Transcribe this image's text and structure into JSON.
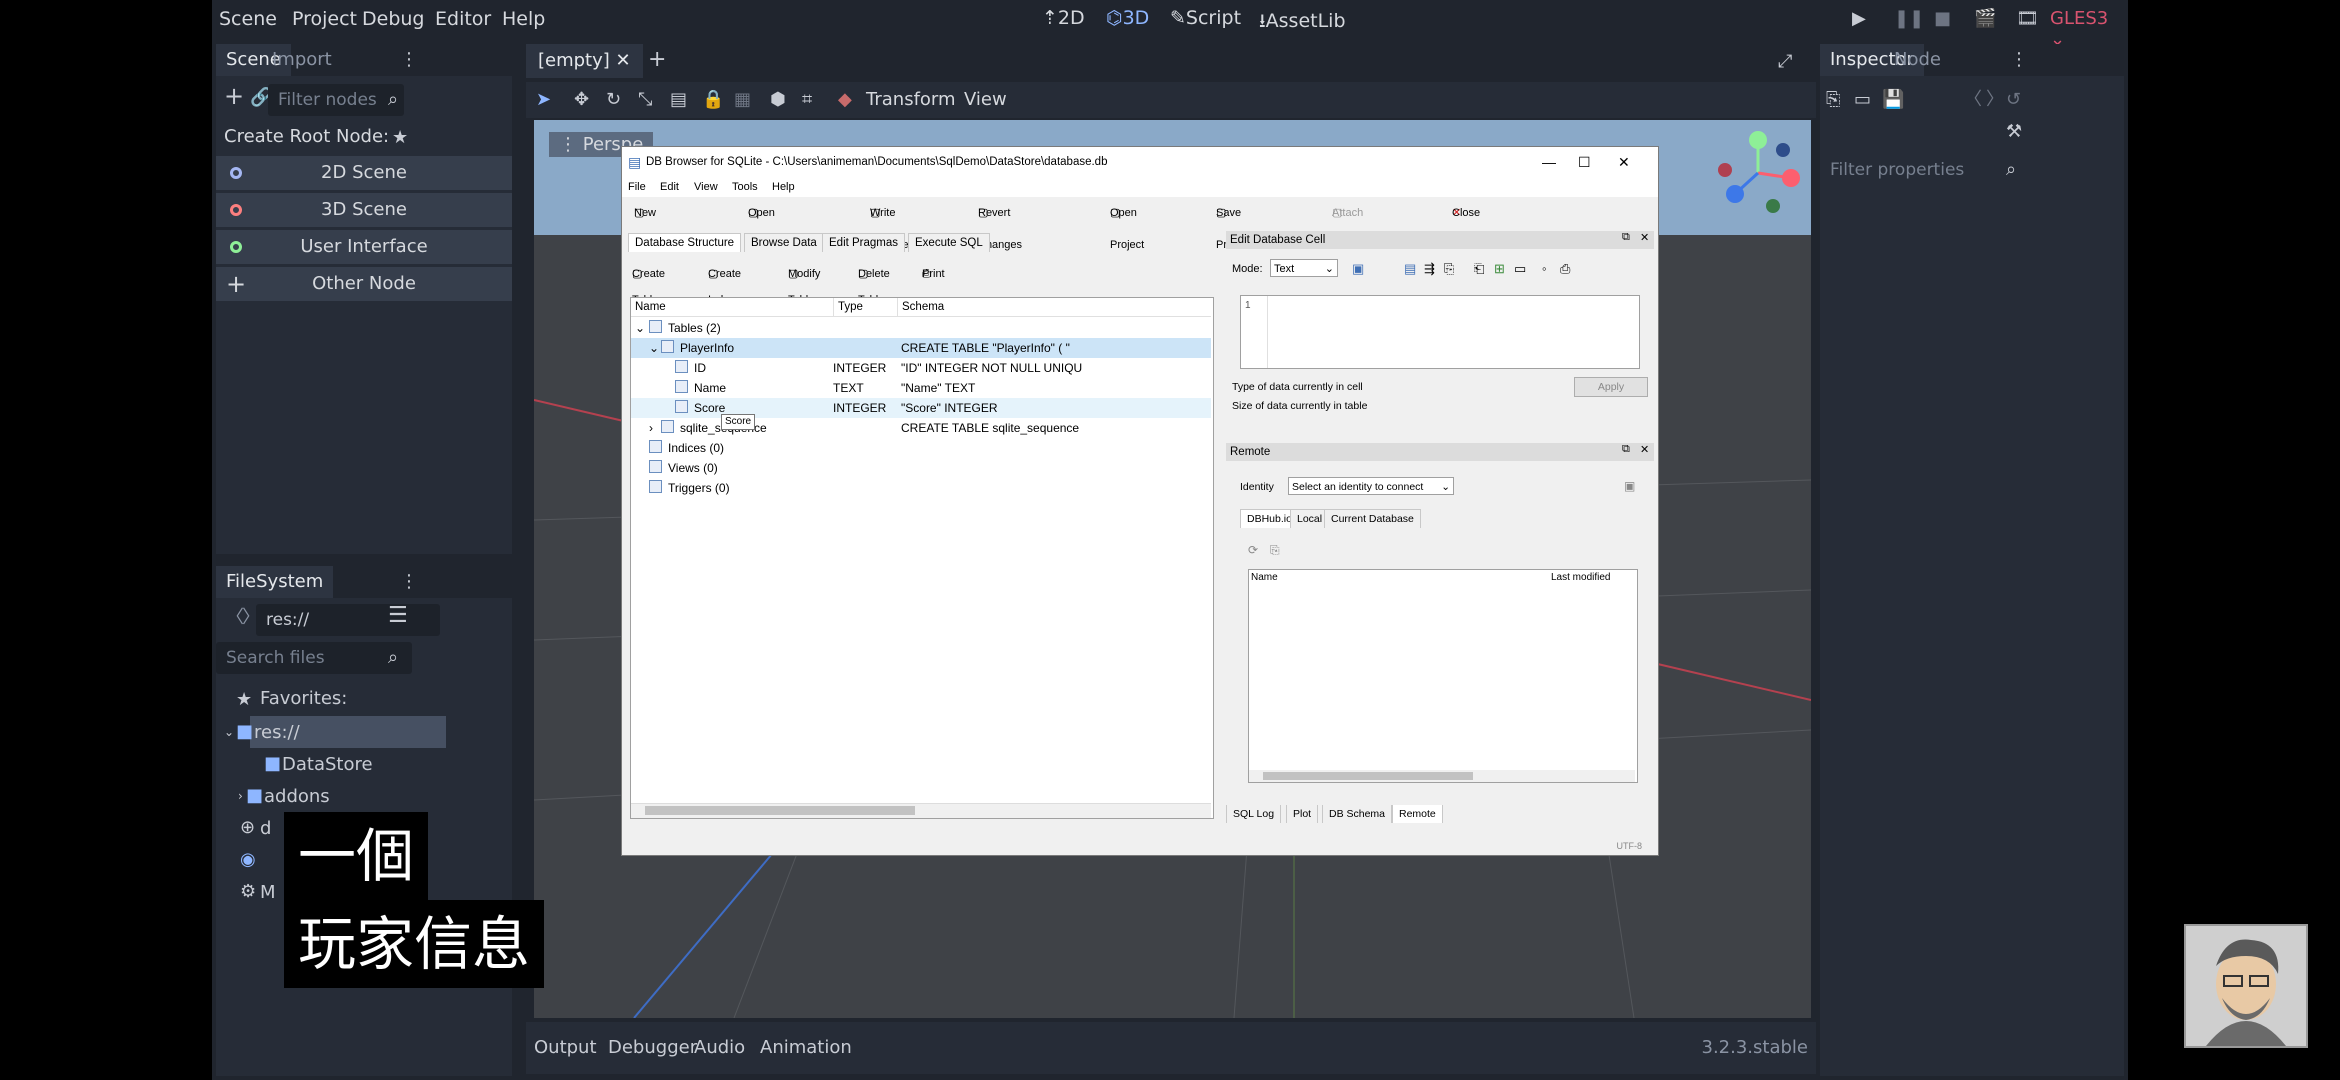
{
  "menu": [
    "Scene",
    "Project",
    "Debug",
    "Editor",
    "Help"
  ],
  "modes": [
    {
      "icon": "2d-mode-icon",
      "glyph": "⇡",
      "label": "2D"
    },
    {
      "icon": "3d-mode-icon",
      "glyph": "⌬",
      "label": "3D"
    },
    {
      "icon": "script-icon",
      "glyph": "✎",
      "label": "Script"
    },
    {
      "icon": "assetlib-icon",
      "glyph": "⭳",
      "label": "AssetLib"
    }
  ],
  "renderer": "GLES3",
  "scene_dock": {
    "tabs": [
      "Scene",
      "Import"
    ],
    "filter_placeholder": "Filter nodes",
    "create_root_label": "Create Root Node:",
    "nodes": [
      {
        "label": "2D Scene",
        "color": "#a5b7f3"
      },
      {
        "label": "3D Scene",
        "color": "#fc7f7f"
      },
      {
        "label": "User Interface",
        "color": "#8eef97"
      },
      {
        "label": "Other Node",
        "color": "#c8ccd4"
      }
    ]
  },
  "filesystem": {
    "title": "FileSystem",
    "path": "res://",
    "search_placeholder": "Search files",
    "favorites": "Favorites:",
    "items": [
      "res://",
      "DataStore",
      "addons",
      "d",
      "M"
    ]
  },
  "editor_tabs": {
    "scene_tab": "[empty]"
  },
  "viewport_toolbar": {
    "transform": "Transform",
    "view": "View",
    "perspective": "Perspe"
  },
  "inspector": {
    "tabs": [
      "Inspector",
      "Node"
    ],
    "filter_placeholder": "Filter properties"
  },
  "bottom_tabs": [
    "Output",
    "Debugger",
    "Audio",
    "Animation"
  ],
  "version": "3.2.3.stable",
  "db_browser": {
    "title": "DB Browser for SQLite - C:\\Users\\animeman\\Documents\\SqlDemo\\DataStore\\database.db",
    "menu": [
      "File",
      "Edit",
      "View",
      "Tools",
      "Help"
    ],
    "toolbar": [
      "New Database",
      "Open Database",
      "Write Changes",
      "Revert Changes",
      "Open Project",
      "Save Project",
      "Attach Database",
      "Close Database"
    ],
    "tabs": [
      "Database Structure",
      "Browse Data",
      "Edit Pragmas",
      "Execute SQL"
    ],
    "subtoolbar": [
      "Create Table",
      "Create Index",
      "Modify Table",
      "Delete Table",
      "Print"
    ],
    "columns": [
      "Name",
      "Type",
      "Schema"
    ],
    "rows": [
      {
        "name": "Tables (2)",
        "type": "",
        "schema": ""
      },
      {
        "name": "PlayerInfo",
        "type": "",
        "schema": "CREATE TABLE \"PlayerInfo\" ( \""
      },
      {
        "name": "ID",
        "type": "INTEGER",
        "schema": "\"ID\" INTEGER NOT NULL UNIQU"
      },
      {
        "name": "Name",
        "type": "TEXT",
        "schema": "\"Name\" TEXT"
      },
      {
        "name": "Score",
        "type": "INTEGER",
        "schema": "\"Score\" INTEGER"
      },
      {
        "name": "sqlite_sequence",
        "type": "",
        "schema": "CREATE TABLE sqlite_sequence"
      },
      {
        "name": "Indices (0)",
        "type": "",
        "schema": ""
      },
      {
        "name": "Views (0)",
        "type": "",
        "schema": ""
      },
      {
        "name": "Triggers (0)",
        "type": "",
        "schema": ""
      }
    ],
    "tooltip": "Score",
    "edit_cell": {
      "title": "Edit Database Cell",
      "mode_label": "Mode:",
      "mode_value": "Text",
      "line_number": "1",
      "type_info": "Type of data currently in cell",
      "size_info": "Size of data currently in table",
      "apply": "Apply"
    },
    "remote": {
      "title": "Remote",
      "identity_label": "Identity",
      "identity_value": "Select an identity to connect",
      "tabs": [
        "DBHub.io",
        "Local",
        "Current Database"
      ],
      "columns": [
        "Name",
        "Last modified"
      ]
    },
    "bottom_tabs": [
      "SQL Log",
      "Plot",
      "DB Schema",
      "Remote"
    ],
    "encoding": "UTF-8"
  },
  "subtitles": [
    "一個",
    "玩家信息"
  ]
}
